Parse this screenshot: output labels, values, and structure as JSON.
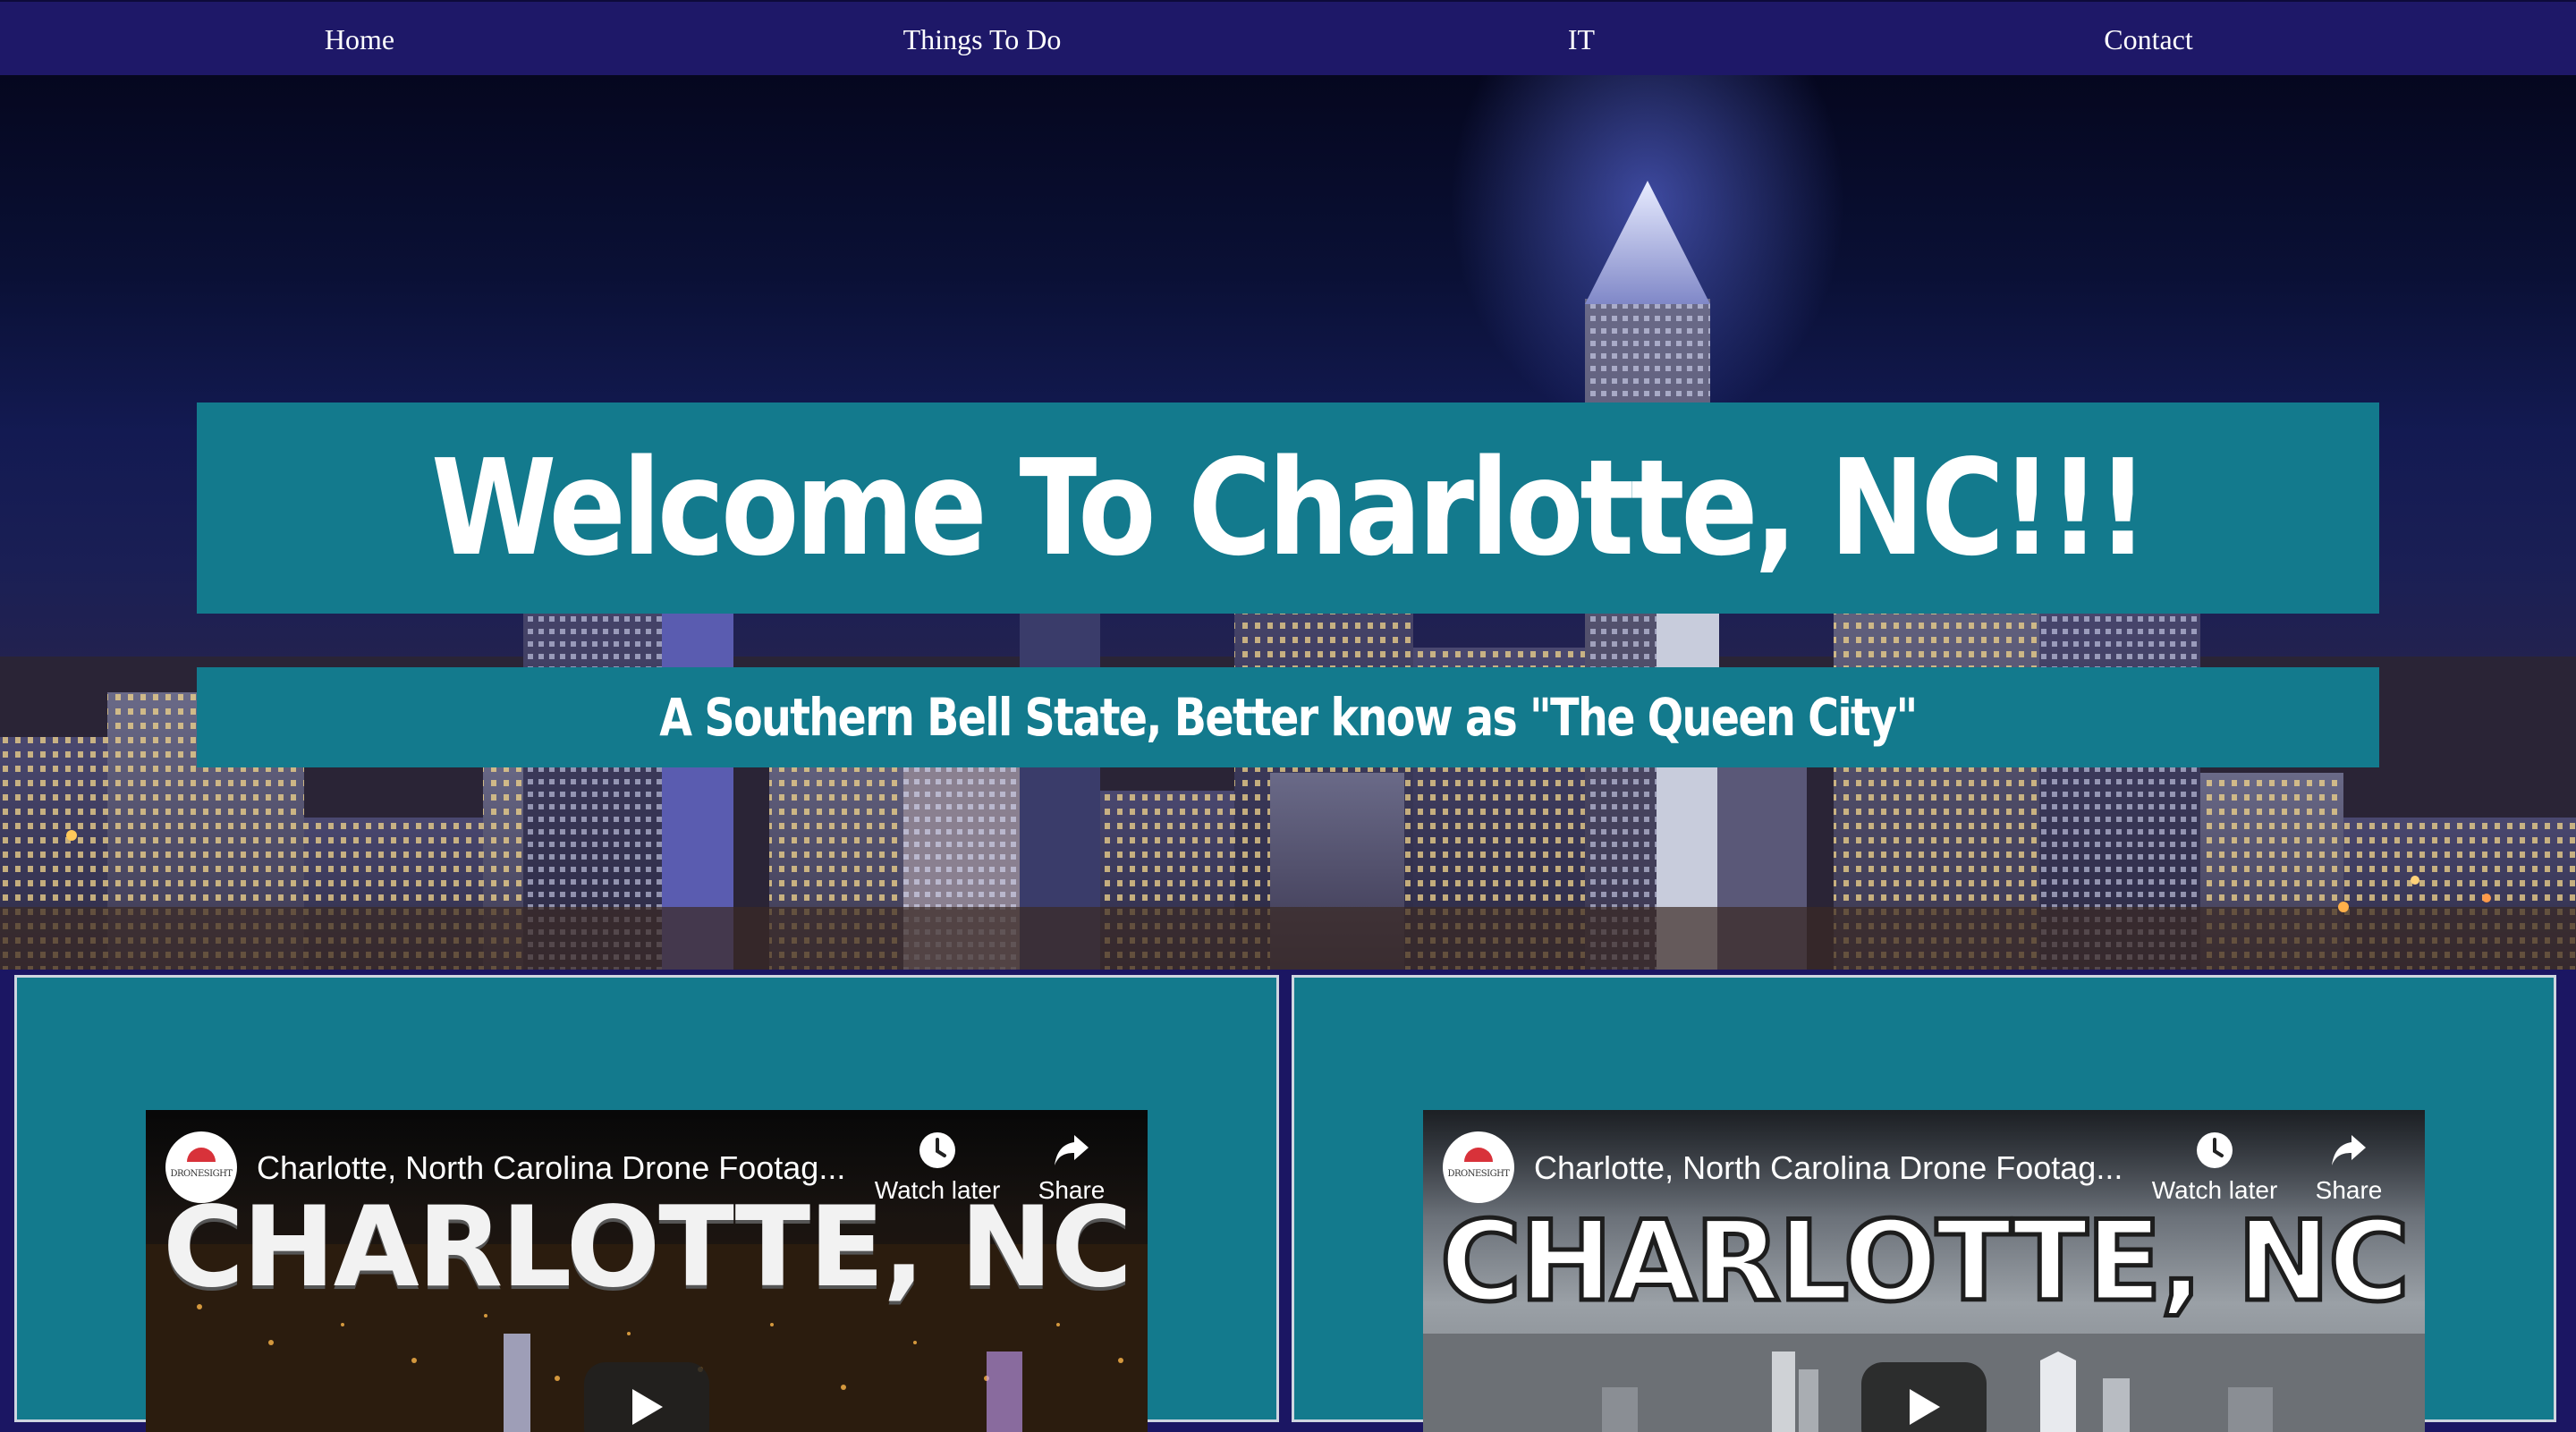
{
  "nav": {
    "items": [
      {
        "label": "Home"
      },
      {
        "label": "Things To Do"
      },
      {
        "label": "IT"
      },
      {
        "label": "Contact"
      }
    ]
  },
  "hero": {
    "title": "Welcome To Charlotte, NC!!!",
    "subtitle": "A Southern Bell State, Better know as \"The Queen City\""
  },
  "videos": [
    {
      "title": "Charlotte, North Carolina Drone Footag...",
      "watch_later_label": "Watch later",
      "share_label": "Share",
      "thumbnail_text": "CHARLOTTE, NC",
      "channel_logo_text": "DRONESIGHT",
      "play_icon": "play-icon"
    },
    {
      "title": "Charlotte, North Carolina Drone Footag...",
      "watch_later_label": "Watch later",
      "share_label": "Share",
      "thumbnail_text": "CHARLOTTE, NC",
      "channel_logo_text": "DRONESIGHT",
      "play_icon": "play-icon"
    }
  ],
  "colors": {
    "nav_bg": "#1e1868",
    "band_teal": "#137a8d",
    "panel_border": "#cfd6e0",
    "page_bg": "#1b1663"
  }
}
